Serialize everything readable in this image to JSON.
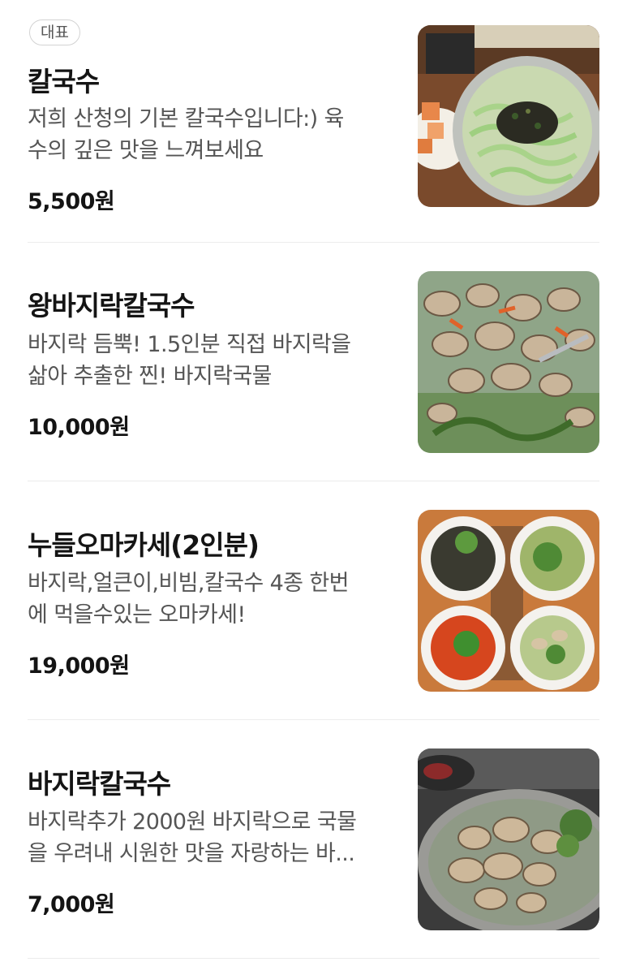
{
  "menu": {
    "items": [
      {
        "badge": "대표",
        "name": "칼국수",
        "description": "저희 산청의 기본 칼국수입니다:) 육\n수의 깊은 맛을 느껴보세요",
        "price": "5,500원"
      },
      {
        "name": "왕바지락칼국수",
        "description": "바지락 듬뿍! 1.5인분 직접 바지락을\n삶아 추출한 찐! 바지락국물",
        "price": "10,000원"
      },
      {
        "name": "누들오마카세(2인분)",
        "description": "바지락,얼큰이,비빔,칼국수 4종 한번\n에 먹을수있는 오마카세!",
        "price": "19,000원"
      },
      {
        "name": "바지락칼국수",
        "description": "바지락추가 2000원 바지락으로 국물\n을 우려내 시원한 맛을 자랑하는 바...",
        "price": "7,000원"
      }
    ]
  },
  "colors": {
    "text_primary": "#141414",
    "text_secondary": "#555555",
    "divider": "#ececec",
    "badge_border": "#d3d3d3"
  }
}
